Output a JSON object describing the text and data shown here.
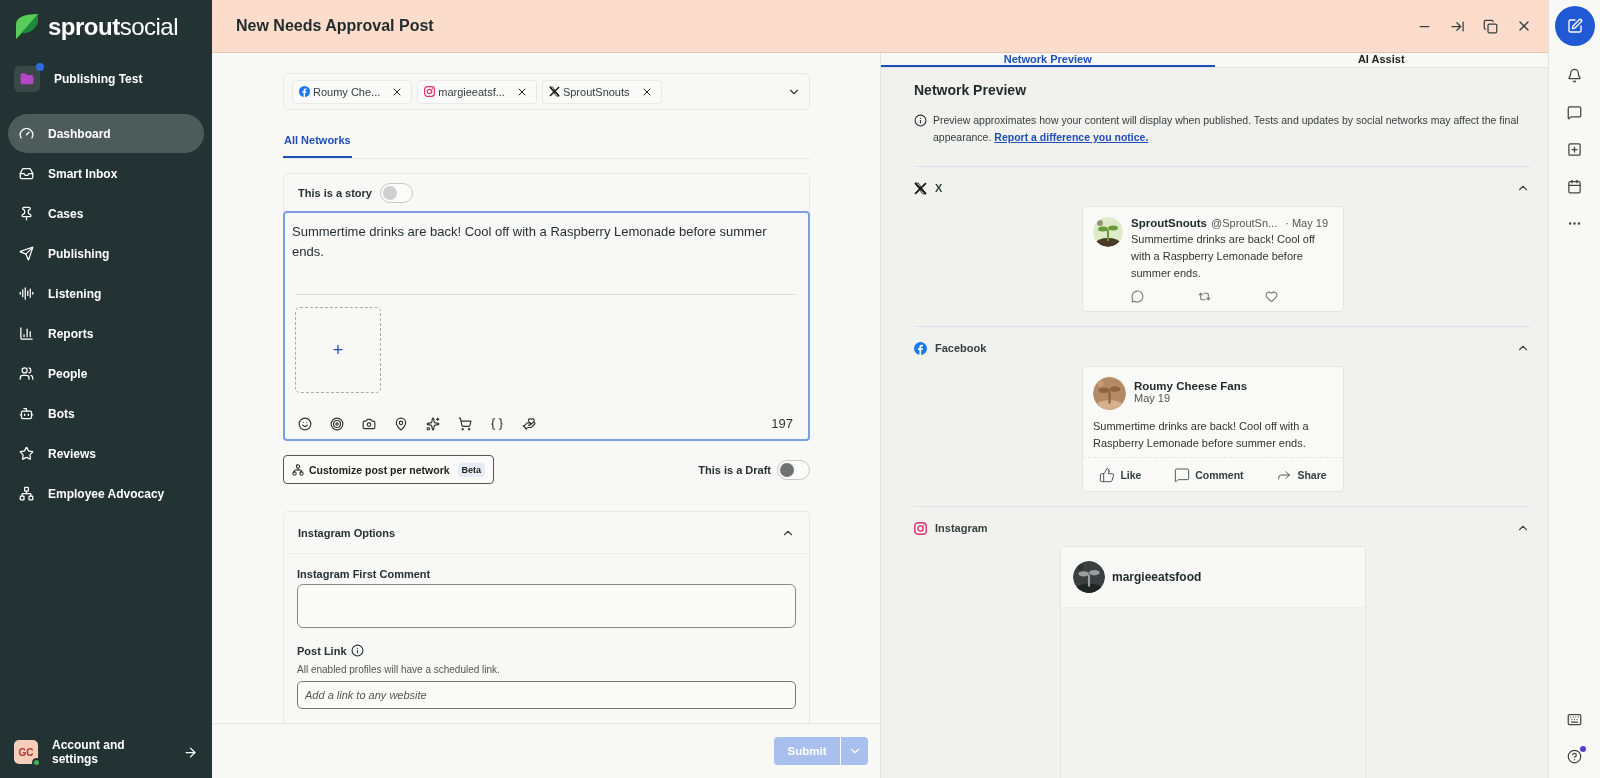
{
  "sidebar": {
    "logo": "**sprout**social",
    "workspace": {
      "name": "Publishing Test",
      "notification": true
    },
    "items": [
      {
        "label": "Dashboard",
        "selected": true
      },
      {
        "label": "Smart Inbox",
        "selected": false
      },
      {
        "label": "Cases",
        "selected": false
      },
      {
        "label": "Publishing",
        "selected": false
      },
      {
        "label": "Listening",
        "selected": false
      },
      {
        "label": "Reports",
        "selected": false
      },
      {
        "label": "People",
        "selected": false
      },
      {
        "label": "Bots",
        "selected": false
      },
      {
        "label": "Reviews",
        "selected": false
      },
      {
        "label": "Employee Advocacy",
        "selected": false
      }
    ],
    "account": {
      "initials": "GC",
      "label": "Account and settings",
      "online": true
    }
  },
  "header": {
    "title": "New Needs Approval Post"
  },
  "composer": {
    "profiles": [
      {
        "kind": "facebook",
        "name": "Roumy Che..."
      },
      {
        "kind": "instagram",
        "name": "margieeatsf..."
      },
      {
        "kind": "x",
        "name": "SproutSnouts"
      }
    ],
    "tabs": [
      {
        "label": "All Networks",
        "selected": true
      }
    ],
    "story": {
      "label": "This is a story",
      "on": false
    },
    "message": "Summertime drinks are back! Cool off with a Raspberry Lemonade before summer ends. ",
    "media_add": "+",
    "char_count": "197",
    "customize": {
      "label": "Customize post per network",
      "badge": "Beta"
    },
    "draft": {
      "label": "This is a Draft",
      "on": false
    },
    "instagram_options": {
      "title": "Instagram Options",
      "expanded": true,
      "first_comment_label": "Instagram First Comment",
      "post_link_label": "Post Link",
      "post_link_hint": "All enabled profiles will have a scheduled link.",
      "post_link_placeholder": "Add a link to any website"
    },
    "submit": {
      "label": "Submit",
      "disabled": true
    }
  },
  "preview": {
    "tabs": [
      {
        "label": "Network Preview",
        "selected": true
      },
      {
        "label": "AI Assist",
        "selected": false
      }
    ],
    "title": "Network Preview",
    "notice": "Preview approximates how your content will display when published. Tests and updates by social networks may affect the final appearance.",
    "notice_link": "Report a difference you notice.",
    "sections": [
      {
        "kind": "x",
        "label": "X",
        "expanded": true,
        "card": {
          "name": "SproutSnouts",
          "handle": "@SproutSn...",
          "date": "· May 19",
          "text": "Summertime drinks are back! Cool off with a Raspberry Lemonade before summer ends."
        }
      },
      {
        "kind": "facebook",
        "label": "Facebook",
        "expanded": true,
        "card": {
          "name": "Roumy Cheese Fans",
          "date": "May 19",
          "text": "Summertime drinks are back! Cool off with a Raspberry Lemonade before summer ends.",
          "actions": [
            "Like",
            "Comment",
            "Share"
          ]
        }
      },
      {
        "kind": "instagram",
        "label": "Instagram",
        "expanded": true,
        "card": {
          "name": "margieeatsfood"
        }
      }
    ]
  }
}
